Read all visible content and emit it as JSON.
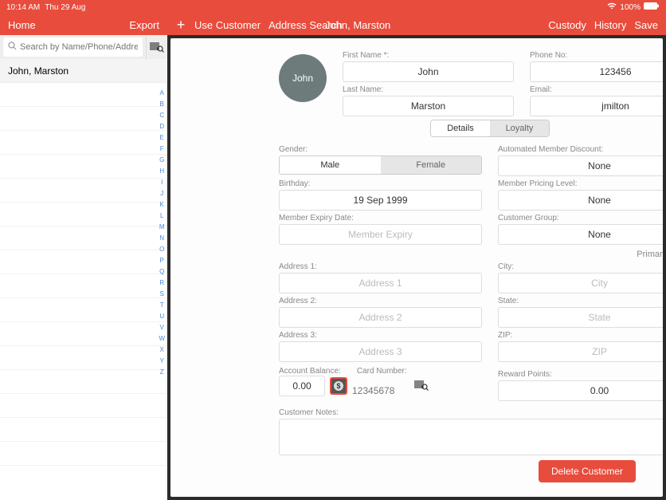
{
  "status": {
    "time": "10:14 AM",
    "date": "Thu 29 Aug",
    "battery": "100%"
  },
  "header": {
    "home": "Home",
    "export": "Export",
    "use_customer": "Use Customer",
    "address_search": "Address Search",
    "title": "John, Marston",
    "custody": "Custody",
    "history": "History",
    "save": "Save"
  },
  "sidebar": {
    "search_placeholder": "Search by Name/Phone/Addre...",
    "customer_name": "John, Marston",
    "alpha": [
      "A",
      "B",
      "C",
      "D",
      "E",
      "F",
      "G",
      "H",
      "I",
      "J",
      "K",
      "L",
      "M",
      "N",
      "O",
      "P",
      "Q",
      "R",
      "S",
      "T",
      "U",
      "V",
      "W",
      "X",
      "Y",
      "Z"
    ]
  },
  "avatar": "John",
  "labels": {
    "first_name": "First Name *:",
    "phone": "Phone No:",
    "last_name": "Last Name:",
    "email": "Email:",
    "details": "Details",
    "loyalty": "Loyalty",
    "gender": "Gender:",
    "male": "Male",
    "female": "Female",
    "discount": "Automated Member Discount:",
    "birthday": "Birthday:",
    "pricing": "Member Pricing Level:",
    "expiry": "Member Expiry Date:",
    "expiry_ph": "Member Expiry",
    "group": "Customer Group:",
    "primary": "Primary Address",
    "addr1": "Address 1:",
    "addr1_ph": "Address 1",
    "city": "City:",
    "city_ph": "City",
    "addr2": "Address 2:",
    "addr2_ph": "Address 2",
    "state": "State:",
    "state_ph": "State",
    "addr3": "Address 3:",
    "addr3_ph": "Address 3",
    "zip": "ZIP:",
    "zip_ph": "ZIP",
    "balance": "Account Balance:",
    "card": "Card Number:",
    "card_ph": "12345678",
    "reward": "Reward Points:",
    "notes": "Customer Notes:",
    "delete": "Delete Customer"
  },
  "values": {
    "first_name": "John",
    "phone": "123456",
    "last_name": "Marston",
    "email": "jmilton",
    "discount": "None",
    "birthday": "19 Sep 1999",
    "pricing": "None",
    "group": "None",
    "balance": "0.00",
    "reward": "0.00"
  }
}
